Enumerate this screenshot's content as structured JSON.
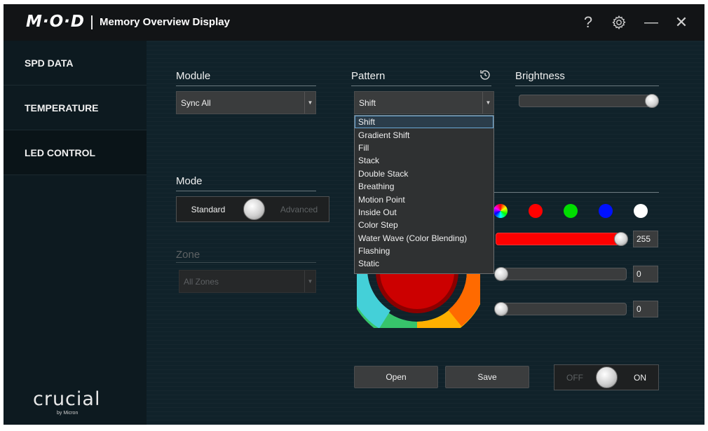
{
  "titlebar": {
    "logo": "M·O·D",
    "title": "Memory Overview Display",
    "help_glyph": "?",
    "settings_icon": "gear-icon",
    "minimize_glyph": "—",
    "close_glyph": "✕"
  },
  "sidebar": {
    "items": [
      {
        "label": "SPD DATA"
      },
      {
        "label": "TEMPERATURE"
      },
      {
        "label": "LED CONTROL",
        "active": true
      }
    ],
    "brand": "crucial",
    "brand_sub": "by Micron"
  },
  "module": {
    "label": "Module",
    "value": "Sync All"
  },
  "pattern": {
    "label": "Pattern",
    "value": "Shift",
    "history_icon": "history-icon",
    "options": [
      "Shift",
      "Gradient Shift",
      "Fill",
      "Stack",
      "Double Stack",
      "Breathing",
      "Motion Point",
      "Inside Out",
      "Color Step",
      "Water Wave (Color Blending)",
      "Flashing",
      "Static"
    ],
    "selected_index": 0
  },
  "brightness": {
    "label": "Brightness",
    "level_percent": 100
  },
  "mode": {
    "label": "Mode",
    "left": "Standard",
    "right": "Advanced"
  },
  "zone": {
    "label": "Zone",
    "value": "All Zones"
  },
  "colors": {
    "swatches": [
      "#ff0000",
      "#00dd00",
      "#0011ff",
      "#ffffff"
    ],
    "red": {
      "value": "255",
      "color": "#ff0000"
    },
    "green": {
      "value": "0"
    },
    "blue": {
      "value": "0"
    }
  },
  "buttons": {
    "open": "Open",
    "save": "Save"
  },
  "power": {
    "off": "OFF",
    "on": "ON",
    "state": "on"
  }
}
